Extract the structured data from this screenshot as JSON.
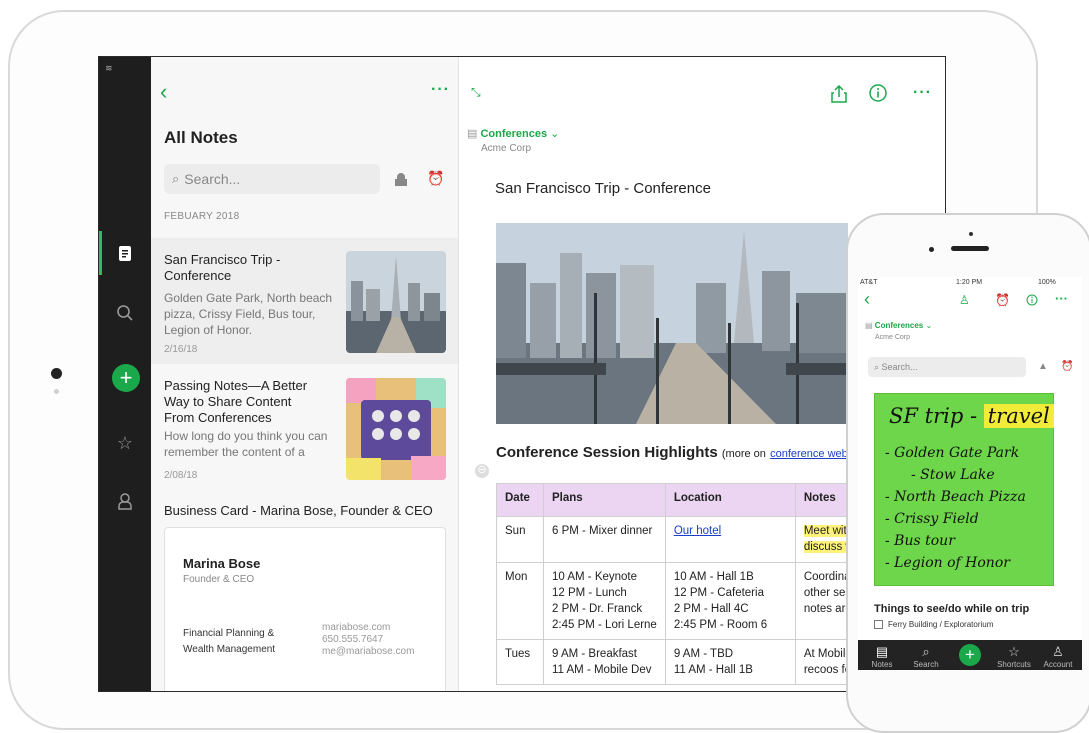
{
  "ipad": {
    "list": {
      "title": "All Notes",
      "search_placeholder": "Search...",
      "month_header": "FEBUARY 2018",
      "notes": [
        {
          "title_line1": "San Francisco Trip -",
          "title_line2": "Conference",
          "snippet_line1": "Golden Gate Park, North beach",
          "snippet_line2": "pizza, Crissy Field, Bus tour,",
          "snippet_line3": "Legion of Honor.",
          "date": "2/16/18"
        },
        {
          "title_line1": "Passing Notes—A Better",
          "title_line2": "Way to Share Content",
          "title_line3": "From Conferences",
          "snippet_line1": "How long do you think you can",
          "snippet_line2": "remember the content of a",
          "date": "2/08/18"
        },
        {
          "title": "Business Card - Marina Bose, Founder & CEO"
        }
      ],
      "business_card": {
        "name": "Marina Bose",
        "role": "Founder & CEO",
        "company_line1": "Financial Planning &",
        "company_line2": "Wealth Management",
        "website": "mariabose.com",
        "phone": "650.555.7647",
        "email": "me@mariabose.com"
      }
    },
    "editor": {
      "notebook": "Conferences",
      "notebook_sub": "Acme Corp",
      "title": "San Francisco Trip - Conference",
      "heading": "Conference Session Highlights",
      "heading_more": "(more on",
      "heading_link": "conference webs",
      "table": {
        "headers": [
          "Date",
          "Plans",
          "Location",
          "Notes"
        ],
        "rows": [
          {
            "date": "Sun",
            "plans": [
              "6 PM - Mixer dinner"
            ],
            "location": [
              "Our hotel"
            ],
            "notes": [
              "Meet with",
              "discuss w"
            ]
          },
          {
            "date": "Mon",
            "plans": [
              "10 AM - Keynote",
              "12 PM - Lunch",
              "2 PM - Dr. Franck",
              "2:45 PM - Lori Lerne"
            ],
            "location": [
              "10 AM - Hall 1B",
              "12 PM - Cafeteria",
              "2 PM - Hall 4C",
              "2:45 PM - Room 6"
            ],
            "notes": [
              "Coordinat",
              "other ses",
              "notes are"
            ]
          },
          {
            "date": "Tues",
            "plans": [
              "9 AM - Breakfast",
              "11 AM - Mobile Dev"
            ],
            "location": [
              "9 AM - TBD",
              "11 AM - Hall 1B"
            ],
            "notes": [
              "At Mobile",
              "recoos for"
            ]
          }
        ]
      }
    }
  },
  "phone": {
    "carrier": "AT&T",
    "time": "1:20 PM",
    "battery": "100%",
    "notebook": "Conferences",
    "notebook_sub": "Acme Corp",
    "search_placeholder": "Search...",
    "handwriting": {
      "title": "SF trip - ",
      "tag": "travel",
      "lines": [
        "- Golden Gate Park",
        "- Stow Lake",
        "- North Beach Pizza",
        "- Crissy Field",
        "- Bus tour",
        "- Legion of Honor"
      ]
    },
    "todo_heading": "Things to see/do while on trip",
    "todo_items": [
      "Ferry Building / Exploratorium"
    ],
    "tabs": [
      "Notes",
      "Search",
      "",
      "Shortcuts",
      "Account"
    ]
  },
  "colors": {
    "accent": "#1aa84a",
    "table_header": "#ebd5f2",
    "highlight": "#fff27a",
    "note_green": "#6ed64a"
  }
}
